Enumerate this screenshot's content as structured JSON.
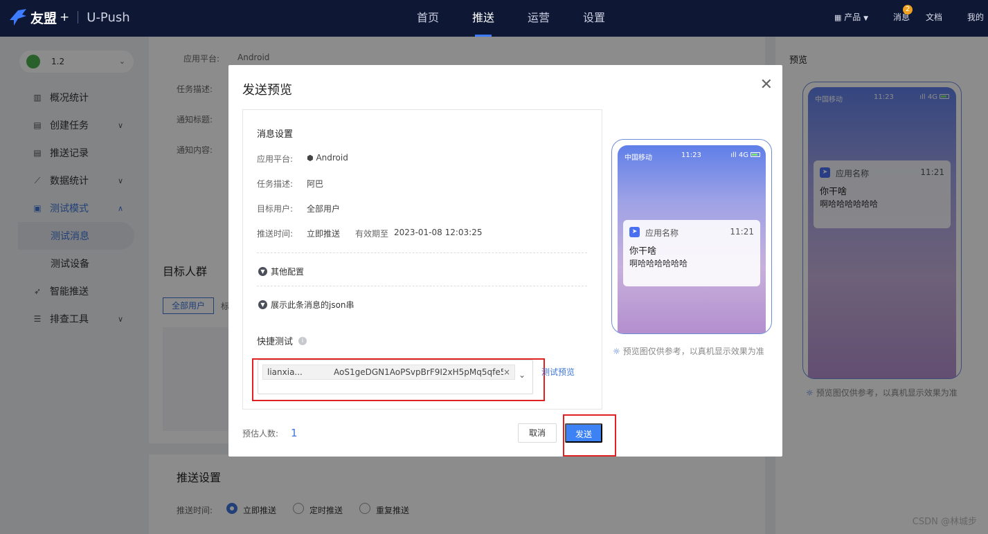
{
  "topbar": {
    "brand": "友盟",
    "plus": "+",
    "product": "U-Push",
    "nav": [
      "首页",
      "推送",
      "运营",
      "设置"
    ],
    "right": {
      "products": "产品",
      "messages": "消息",
      "message_count": "2",
      "docs": "文档",
      "mine": "我的"
    }
  },
  "sidebar": {
    "app_version": "1.2",
    "menu": {
      "overview": "概况统计",
      "create": "创建任务",
      "records": "推送记录",
      "data": "数据统计",
      "test_mode": "测试模式",
      "test_message": "测试消息",
      "test_device": "测试设备",
      "smart": "智能推送",
      "troubleshoot": "排查工具"
    }
  },
  "background": {
    "platform_label": "应用平台:",
    "platform_value": "Android",
    "task_desc": "任务描述:",
    "notif_title": "通知标题:",
    "notif_content": "通知内容:",
    "target_group": "目标人群",
    "all_users_tab": "全部用户",
    "other_tab": "标",
    "push_settings": "推送设置",
    "push_time": "推送时间:",
    "radio_now": "立即推送",
    "radio_scheduled": "定时推送",
    "radio_repeat": "重复推送",
    "preview_title": "预览"
  },
  "modal": {
    "title": "发送预览",
    "section": "消息设置",
    "platform_k": "应用平台:",
    "platform_v": "Android",
    "desc_k": "任务描述:",
    "desc_v": "阿巴",
    "target_k": "目标用户:",
    "target_v": "全部用户",
    "time_k": "推送时间:",
    "time_v": "立即推送",
    "valid_k": "有效期至",
    "valid_v": "2023-01-08 12:03:25",
    "other_config": "其他配置",
    "show_json": "展示此条消息的json串",
    "quick_test": "快捷测试",
    "tag_name": "lianxia...",
    "tag_token": "AoS1geDGN1AoPSvpBrF9I2xH5pMq5qfe5...",
    "test_preview": "测试预览",
    "estimate_label": "预估人数:",
    "estimate_value": "1",
    "cancel": "取消",
    "send": "发送"
  },
  "phone": {
    "carrier": "中国移动",
    "time": "11:23",
    "signal": "4G",
    "app_name": "应用名称",
    "notif_time": "11:21",
    "notif_title": "你干啥",
    "notif_body": "啊哈哈哈哈哈哈",
    "hint": "预览图仅供参考，以真机显示效果为准"
  },
  "watermark": "CSDN @林城步",
  "colors": {
    "accent": "#3d82f5",
    "topbar": "#0e1734",
    "highlight": "#e02020"
  }
}
